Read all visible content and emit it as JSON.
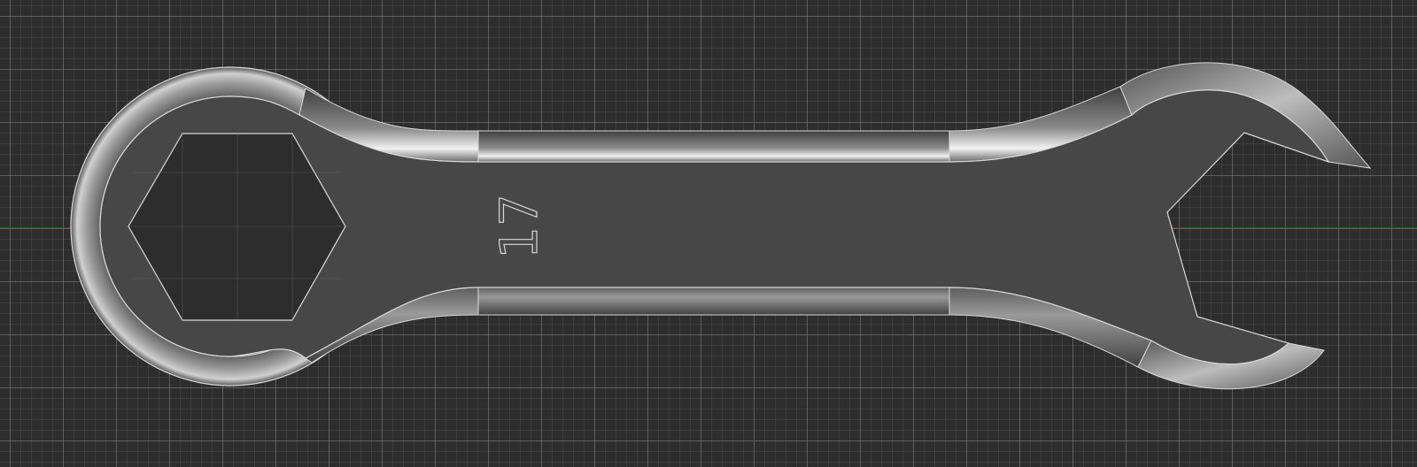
{
  "viewport": {
    "background": "#2d2d2d",
    "grid_major_color": "#787878",
    "grid_minor_color": "#5a5a5a",
    "axis_x_color": "#7a3434",
    "axis_y_color": "#2f7a2f"
  },
  "model": {
    "body_color": "#474747",
    "edge_color": "#d8d8d8",
    "size_label": "17"
  }
}
